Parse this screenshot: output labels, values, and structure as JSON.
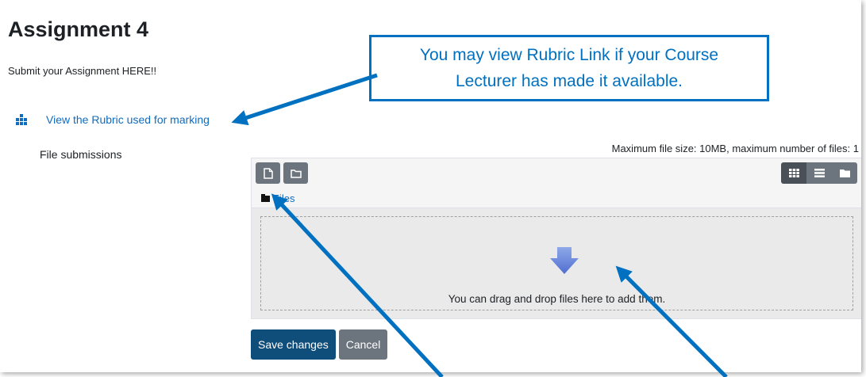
{
  "page": {
    "title": "Assignment 4",
    "intro": "Submit your Assignment HERE!!"
  },
  "rubric": {
    "link_label": "View the Rubric used for marking",
    "icon": "grid-icon"
  },
  "submission": {
    "label": "File submissions",
    "limits": "Maximum file size: 10MB, maximum number of files: 1"
  },
  "filepicker": {
    "toolbar_left": [
      {
        "icon": "file-icon"
      },
      {
        "icon": "folder-icon"
      }
    ],
    "toolbar_right": [
      {
        "icon": "grid-view-icon"
      },
      {
        "icon": "list-view-icon"
      },
      {
        "icon": "tree-view-icon"
      }
    ],
    "path_label": "Files",
    "drop_text": "You can drag and drop files here to add them.",
    "drop_icon": "down-arrow-icon"
  },
  "actions": {
    "save_label": "Save changes",
    "cancel_label": "Cancel"
  },
  "callout": {
    "line1": "You may view Rubric Link if your Course",
    "line2": "Lecturer has made it available."
  },
  "colors": {
    "accent": "#0070c0",
    "link": "#0f6cbf",
    "primary_button": "#0f4d7a",
    "secondary_button": "#6c757d"
  }
}
